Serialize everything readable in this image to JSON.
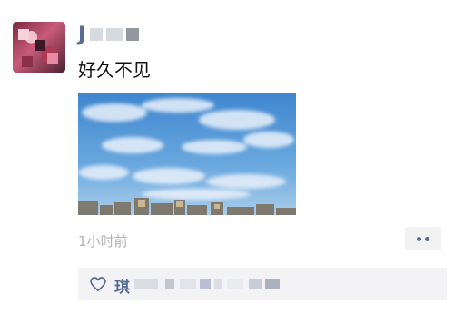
{
  "post": {
    "username": "J",
    "text": "好久不见",
    "timestamp": "1小时前"
  },
  "likes": {
    "first_liker": "琪"
  },
  "icons": {
    "like": "heart-outline-icon",
    "more": "more-dots-icon"
  },
  "colors": {
    "name_link": "#576b95",
    "timestamp": "#b2b2b2",
    "like_panel_bg": "#f3f3f5"
  }
}
